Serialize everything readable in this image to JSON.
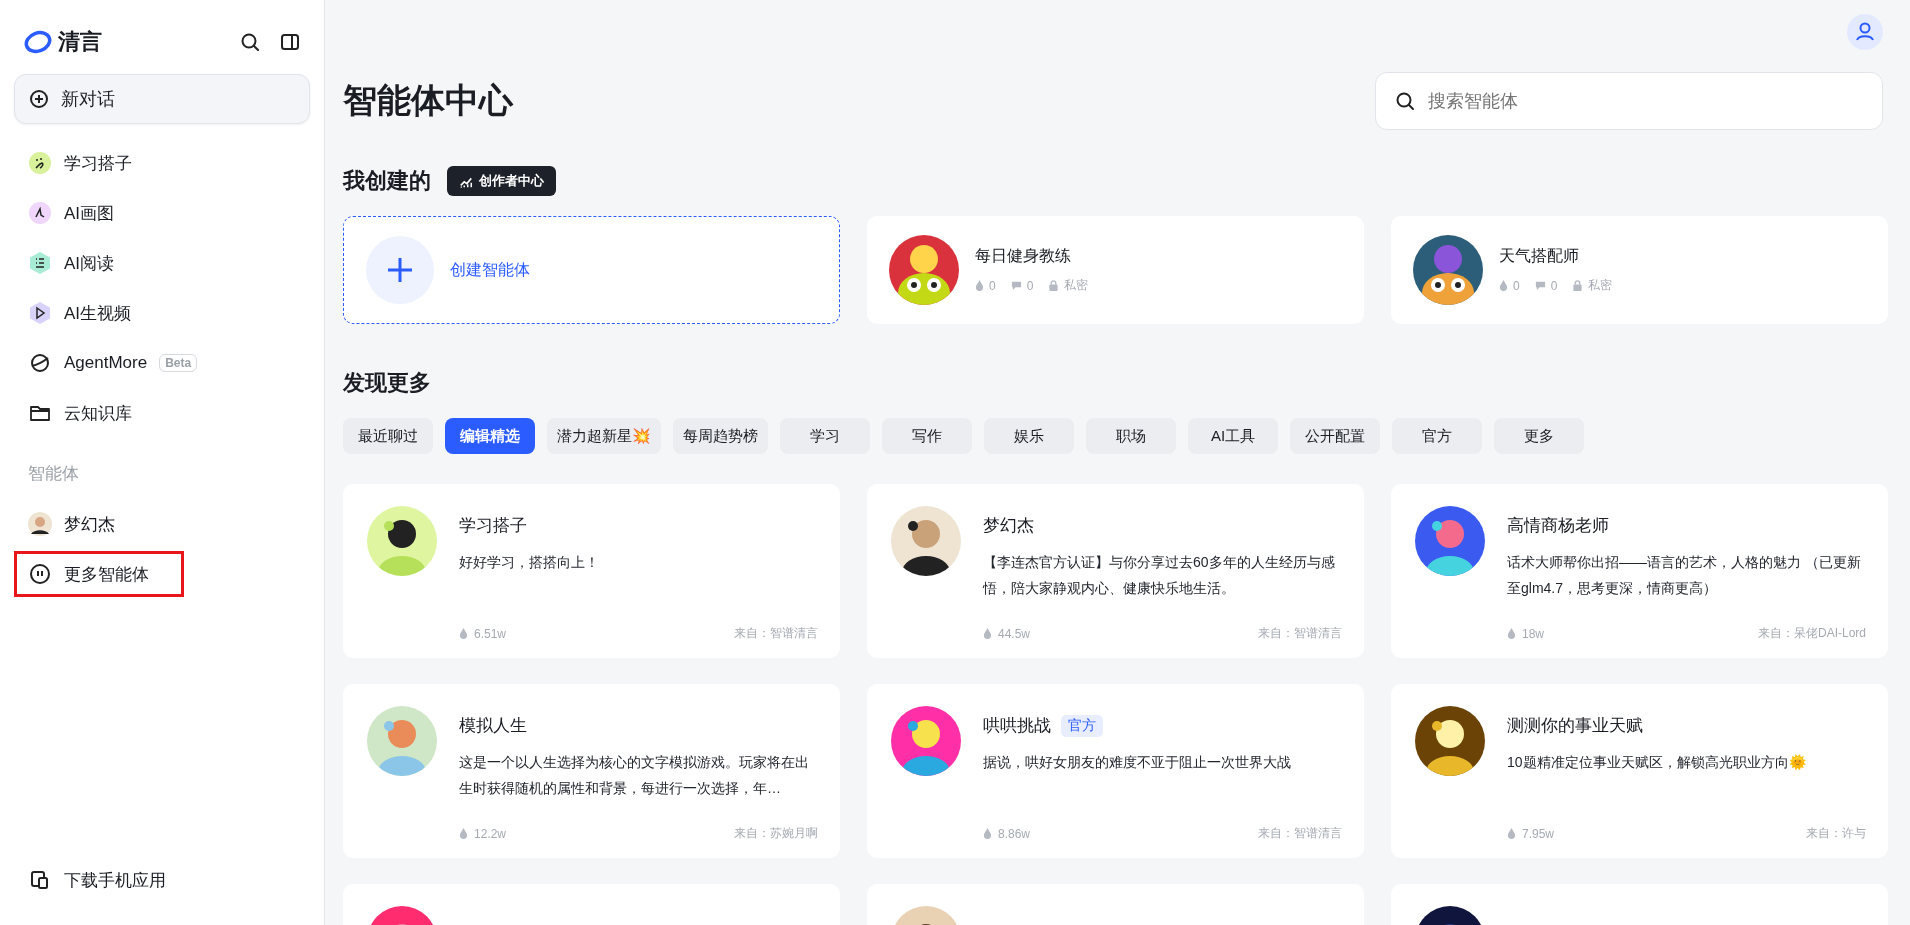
{
  "sidebar": {
    "brand": "清言",
    "new_chat": "新对话",
    "nav": [
      {
        "label": "学习搭子",
        "kind": "study"
      },
      {
        "label": "AI画图",
        "kind": "draw"
      },
      {
        "label": "AI阅读",
        "kind": "read"
      },
      {
        "label": "AI生视频",
        "kind": "video"
      },
      {
        "label": "AgentMore",
        "kind": "agent",
        "badge": "Beta"
      },
      {
        "label": "云知识库",
        "kind": "folder"
      }
    ],
    "section_title": "智能体",
    "agents": [
      {
        "label": "梦幻杰",
        "kind": "avatar",
        "highlighted": false
      },
      {
        "label": "更多智能体",
        "kind": "more",
        "highlighted": true
      }
    ],
    "download": "下载手机应用"
  },
  "page": {
    "title": "智能体中心",
    "search": {
      "placeholder": "搜索智能体"
    }
  },
  "mine": {
    "title": "我创建的",
    "creator_button": "创作者中心",
    "create_label": "创建智能体",
    "cards": [
      {
        "name": "每日健身教练",
        "likes": "0",
        "comments": "0",
        "visibility": "私密"
      },
      {
        "name": "天气搭配师",
        "likes": "0",
        "comments": "0",
        "visibility": "私密"
      }
    ]
  },
  "discover": {
    "title": "发现更多",
    "tabs": [
      {
        "label": "最近聊过",
        "selected": false
      },
      {
        "label": "编辑精选",
        "selected": true
      },
      {
        "label": "潜力超新星💥",
        "selected": false
      },
      {
        "label": "每周趋势榜",
        "selected": false
      },
      {
        "label": "学习",
        "selected": false
      },
      {
        "label": "写作",
        "selected": false
      },
      {
        "label": "娱乐",
        "selected": false
      },
      {
        "label": "职场",
        "selected": false
      },
      {
        "label": "AI工具",
        "selected": false
      },
      {
        "label": "公开配置",
        "selected": false
      },
      {
        "label": "官方",
        "selected": false
      },
      {
        "label": "更多",
        "selected": false
      }
    ],
    "cards": [
      {
        "name": "学习搭子",
        "description": "好好学习，搭搭向上！",
        "uses": "6.51w",
        "source": "来自：智谱清言"
      },
      {
        "name": "梦幻杰",
        "description": "【李连杰官方认证】与你分享过去60多年的人生经历与感悟，陪大家静观内心、健康快乐地生活。",
        "uses": "44.5w",
        "source": "来自：智谱清言"
      },
      {
        "name": "高情商杨老师",
        "description": "话术大师帮你出招——语言的艺术，人格的魅力 （已更新至glm4.7，思考更深，情商更高）",
        "uses": "18w",
        "source": "来自：呆佬DAI-Lord"
      },
      {
        "name": "模拟人生",
        "description": "这是一个以人生选择为核心的文字模拟游戏。玩家将在出生时获得随机的属性和背景，每进行一次选择，年…",
        "uses": "12.2w",
        "source": "来自：苏婉月啊"
      },
      {
        "name": "哄哄挑战",
        "badge": "官方",
        "description": "据说，哄好女朋友的难度不亚于阻止一次世界大战",
        "uses": "8.86w",
        "source": "来自：智谱清言"
      },
      {
        "name": "测测你的事业天赋",
        "description": "10题精准定位事业天赋区，解锁高光职业方向🌞",
        "uses": "7.95w",
        "source": "来自：许与"
      }
    ]
  }
}
